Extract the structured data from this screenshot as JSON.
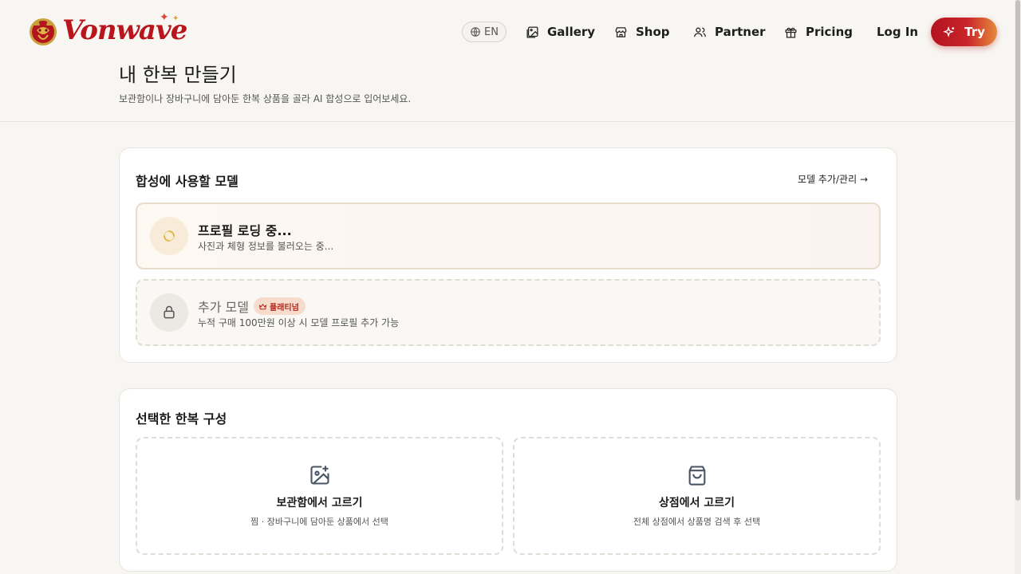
{
  "header": {
    "logo_text": "Vonwave",
    "lang": "EN",
    "nav": [
      {
        "label": "Gallery",
        "icon": "image-icon"
      },
      {
        "label": "Shop",
        "icon": "store-icon"
      },
      {
        "label": "Partner",
        "icon": "users-icon"
      },
      {
        "label": "Pricing",
        "icon": "gift-icon"
      }
    ],
    "login": "Log In",
    "try": "Try"
  },
  "page": {
    "title": "내 한복 만들기",
    "subtitle": "보관함이나 장바구니에 담아둔 한복 상품을 골라 AI 합성으로 입어보세요."
  },
  "model_card": {
    "title": "합성에 사용할 모델",
    "manage_link": "모델 추가/관리 →",
    "loading": {
      "name": "프로필 로딩 중...",
      "desc": "사진과 체형 정보를 불러오는 중..."
    },
    "locked": {
      "name": "추가 모델",
      "badge": "플래티넘",
      "desc": "누적 구매 100만원 이상 시 모델 프로필 추가 가능"
    }
  },
  "hanbok_card": {
    "title": "선택한 한복 구성",
    "options": [
      {
        "title": "보관함에서 고르기",
        "desc": "찜 · 장바구니에 담아둔 상품에서 선택",
        "icon": "image-plus-icon"
      },
      {
        "title": "상점에서 고르기",
        "desc": "전체 상점에서 상품명 검색 후 선택",
        "icon": "shopping-bag-icon"
      }
    ]
  },
  "colors": {
    "brand": "#b8151c",
    "accent": "#e68a3a",
    "background": "#f8f6f2"
  }
}
